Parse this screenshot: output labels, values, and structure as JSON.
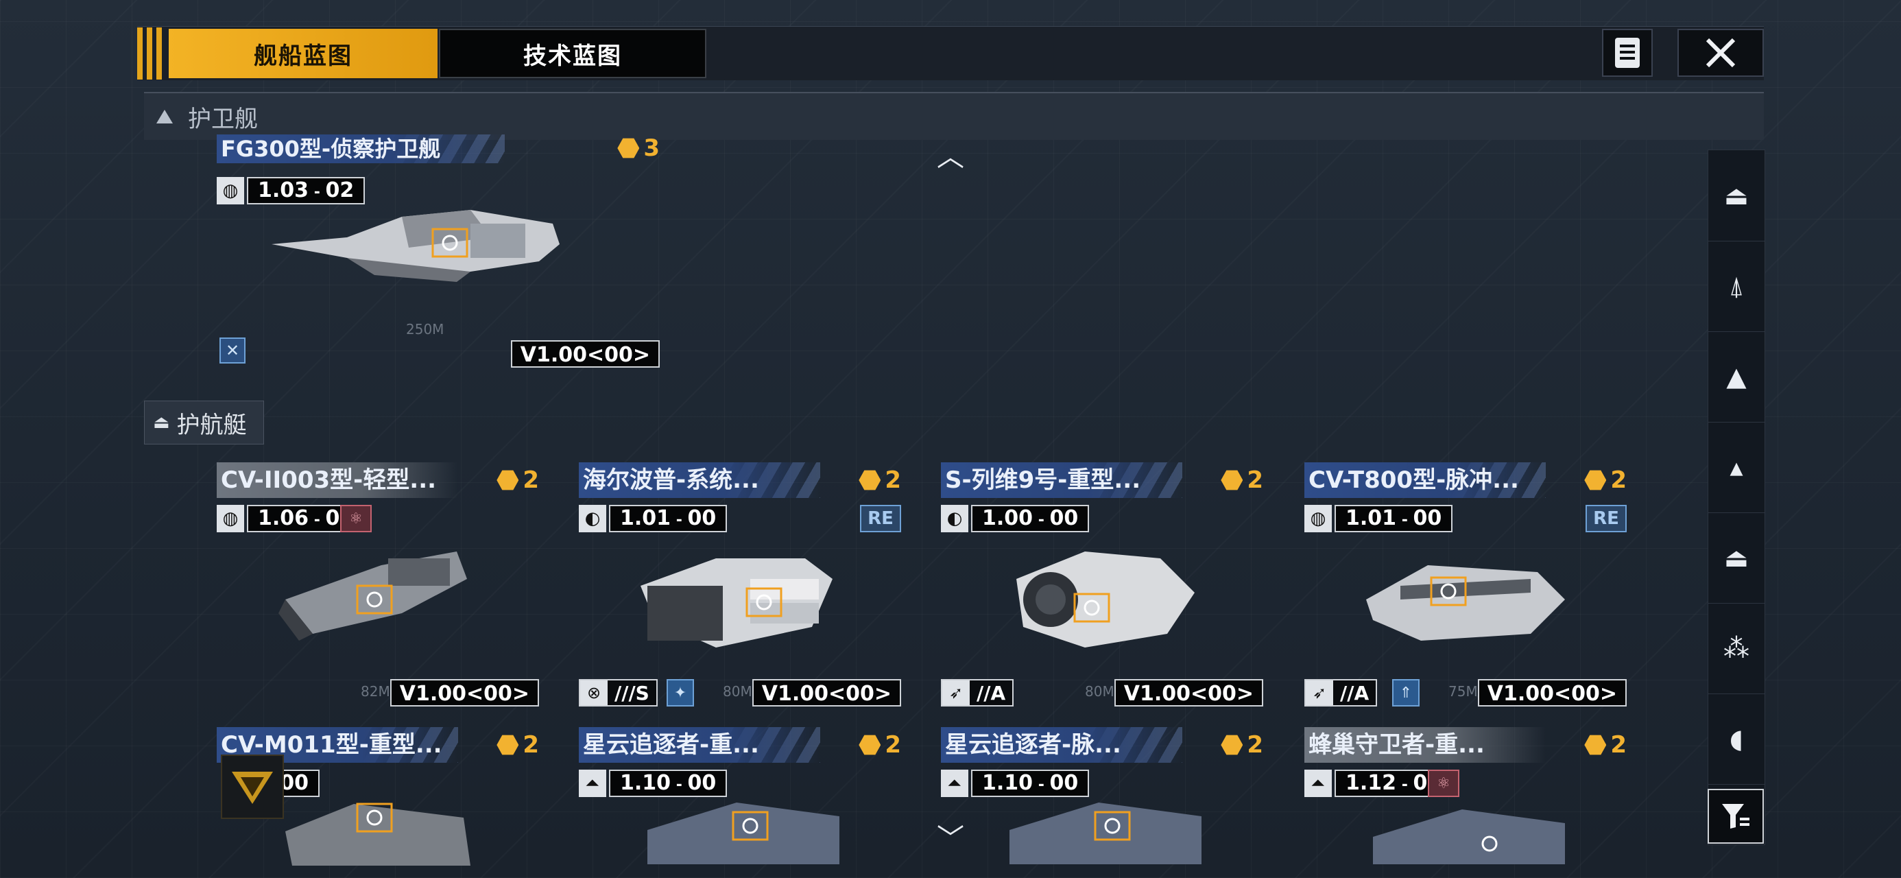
{
  "tabs": {
    "active": "舰船蓝图",
    "inactive": "技术蓝图"
  },
  "header_icons": {
    "notes": "notes-icon",
    "close": "close-icon"
  },
  "section": {
    "title": "护卫舰"
  },
  "frigate": {
    "name": "FG300型-侦察护卫舰",
    "cost": "3",
    "version_num": "1.03",
    "version_sub": "02",
    "version_tag": "V1.00<00>",
    "scale": "250M"
  },
  "subsection": {
    "title": "护航艇"
  },
  "cards": [
    {
      "name": "CV-II003型-轻型...",
      "cost": "2",
      "version_num": "1.06",
      "version_sub": "00",
      "version_tag": "V1.00<00>",
      "role": "",
      "scale": "82M",
      "grey": true
    },
    {
      "name": "海尔波普-系统...",
      "cost": "2",
      "version_num": "1.01",
      "version_sub": "00",
      "version_tag": "V1.00<00>",
      "role": "///S",
      "tag": "RE",
      "scale": "80M",
      "grey": false
    },
    {
      "name": "S-列维9号-重型...",
      "cost": "2",
      "version_num": "1.00",
      "version_sub": "00",
      "version_tag": "V1.00<00>",
      "role": "//A",
      "scale": "80M",
      "grey": false
    },
    {
      "name": "CV-T800型-脉冲...",
      "cost": "2",
      "version_num": "1.01",
      "version_sub": "00",
      "version_tag": "V1.00<00>",
      "role": "//A",
      "tag": "RE",
      "scale": "75M",
      "grey": false
    },
    {
      "name": "CV-M011型-重型...",
      "cost": "2",
      "version_num": "2.00",
      "version_sub": "",
      "grey": true
    },
    {
      "name": "星云追逐者-重...",
      "cost": "2",
      "version_num": "1.10",
      "version_sub": "00",
      "grey": false
    },
    {
      "name": "星云追逐者-脉...",
      "cost": "2",
      "version_num": "1.10",
      "version_sub": "00",
      "grey": false
    },
    {
      "name": "蜂巢守卫者-重...",
      "cost": "2",
      "version_num": "1.12",
      "version_sub": "00",
      "grey": true
    }
  ],
  "side_nav": [
    "battleship-icon",
    "cruiser-icon",
    "destroyer-icon",
    "frigate-icon",
    "corvette-icon",
    "fighter-icon",
    "carrier-icon"
  ],
  "filter": "filter-icon"
}
